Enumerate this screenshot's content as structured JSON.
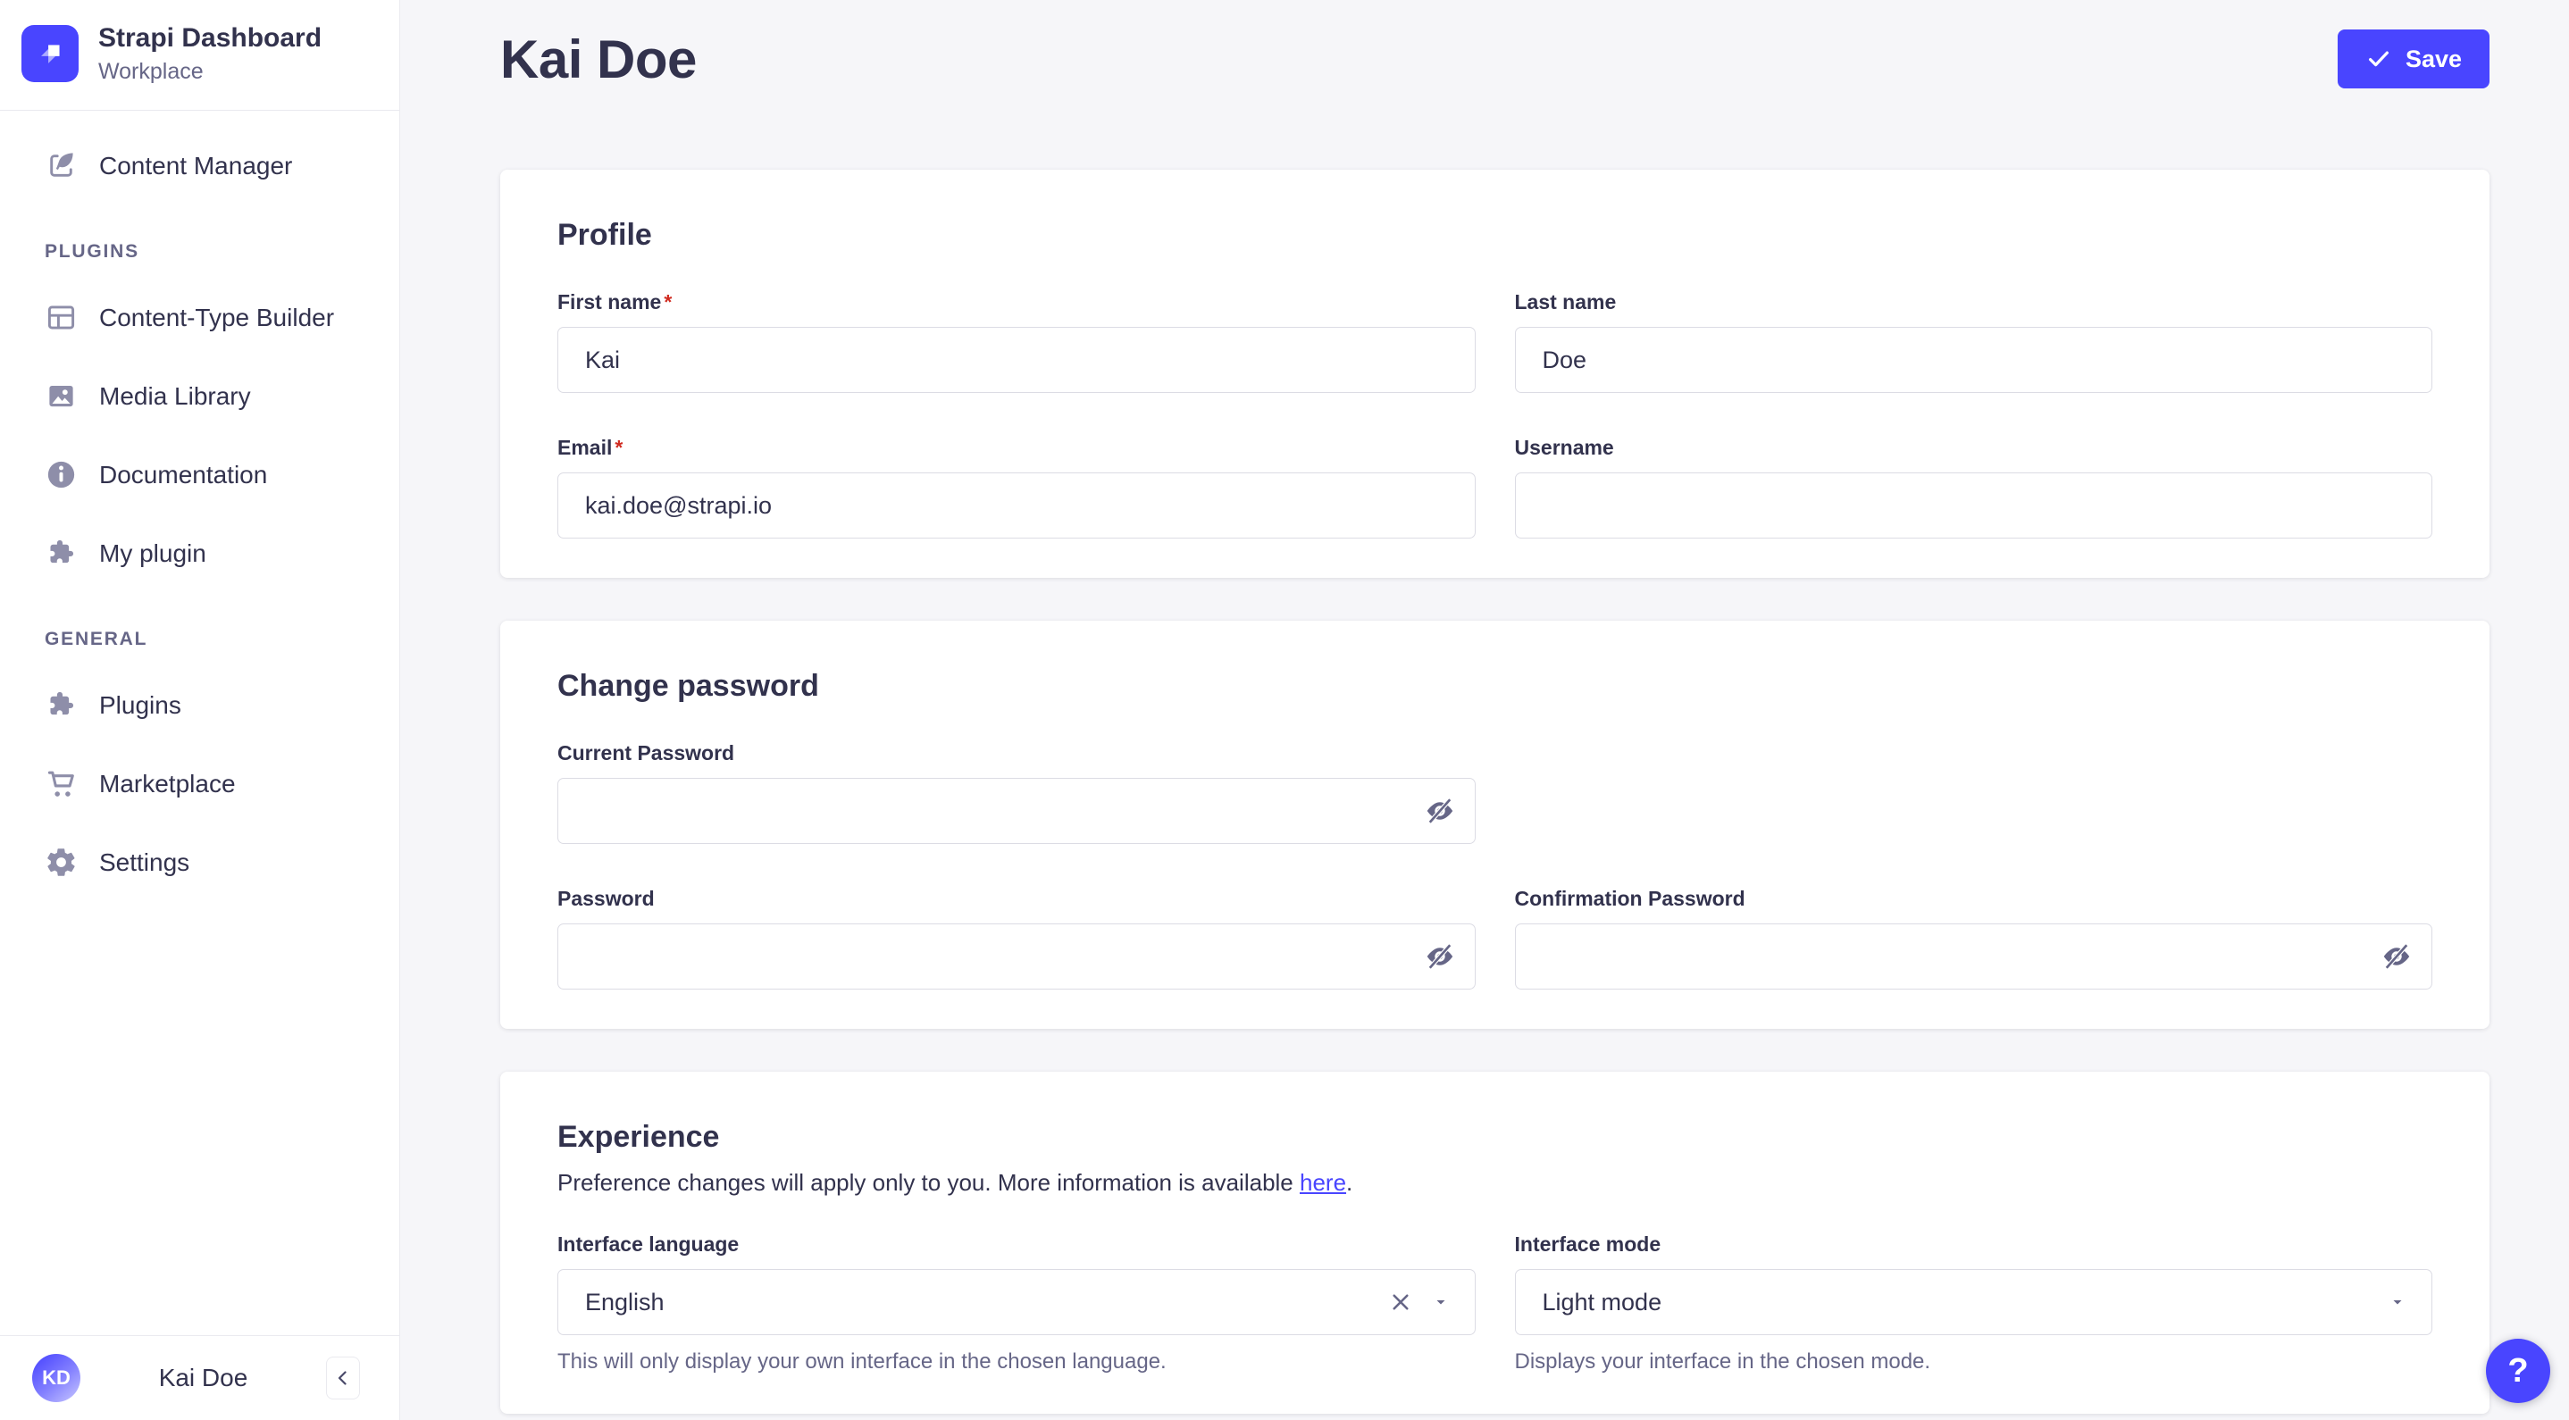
{
  "colors": {
    "accent": "#4945ff",
    "danger": "#d02b20",
    "background": "#f6f6f9",
    "sidebar_icon": "#8e8ea9",
    "muted_text": "#666687",
    "text": "#32324d"
  },
  "sidebar": {
    "brand": {
      "title": "Strapi Dashboard",
      "subtitle": "Workplace",
      "logo_icon": "strapi-logo"
    },
    "sections": [
      {
        "items": [
          {
            "label": "Content Manager",
            "icon": "feather-icon"
          }
        ]
      },
      {
        "heading": "PLUGINS",
        "items": [
          {
            "label": "Content-Type Builder",
            "icon": "layout-grid-icon"
          },
          {
            "label": "Media Library",
            "icon": "image-icon"
          },
          {
            "label": "Documentation",
            "icon": "info-icon"
          },
          {
            "label": "My plugin",
            "icon": "puzzle-icon"
          }
        ]
      },
      {
        "heading": "GENERAL",
        "items": [
          {
            "label": "Plugins",
            "icon": "puzzle-icon"
          },
          {
            "label": "Marketplace",
            "icon": "cart-icon"
          },
          {
            "label": "Settings",
            "icon": "gear-icon"
          }
        ]
      }
    ],
    "user": {
      "initials": "KD",
      "name": "Kai Doe",
      "collapse_icon": "chevron-left-icon"
    }
  },
  "header": {
    "title": "Kai Doe",
    "save_label": "Save",
    "save_icon": "check-icon"
  },
  "profile": {
    "heading": "Profile",
    "fields": [
      {
        "label": "First name",
        "required": "*",
        "value": "Kai"
      },
      {
        "label": "Last name",
        "value": "Doe"
      },
      {
        "label": "Email",
        "required": "*",
        "value": "kai.doe@strapi.io"
      },
      {
        "label": "Username",
        "value": ""
      }
    ]
  },
  "password": {
    "heading": "Change password",
    "fields": [
      {
        "label": "Current Password",
        "icon": "eye-off-icon"
      },
      {
        "label": "Password",
        "icon": "eye-off-icon"
      },
      {
        "label": "Confirmation Password",
        "icon": "eye-off-icon"
      }
    ]
  },
  "experience": {
    "heading": "Experience",
    "description_before": "Preference changes will apply only to you. More information is available ",
    "description_link": "here",
    "description_after": ".",
    "language": {
      "label": "Interface language",
      "value": "English",
      "hint": "This will only display your own interface in the chosen language.",
      "icons": [
        "clear-icon",
        "caret-down-icon"
      ]
    },
    "mode": {
      "label": "Interface mode",
      "value": "Light mode",
      "hint": "Displays your interface in the chosen mode.",
      "icons": [
        "caret-down-icon"
      ]
    }
  },
  "help": {
    "label": "?",
    "icon": "question-icon"
  }
}
